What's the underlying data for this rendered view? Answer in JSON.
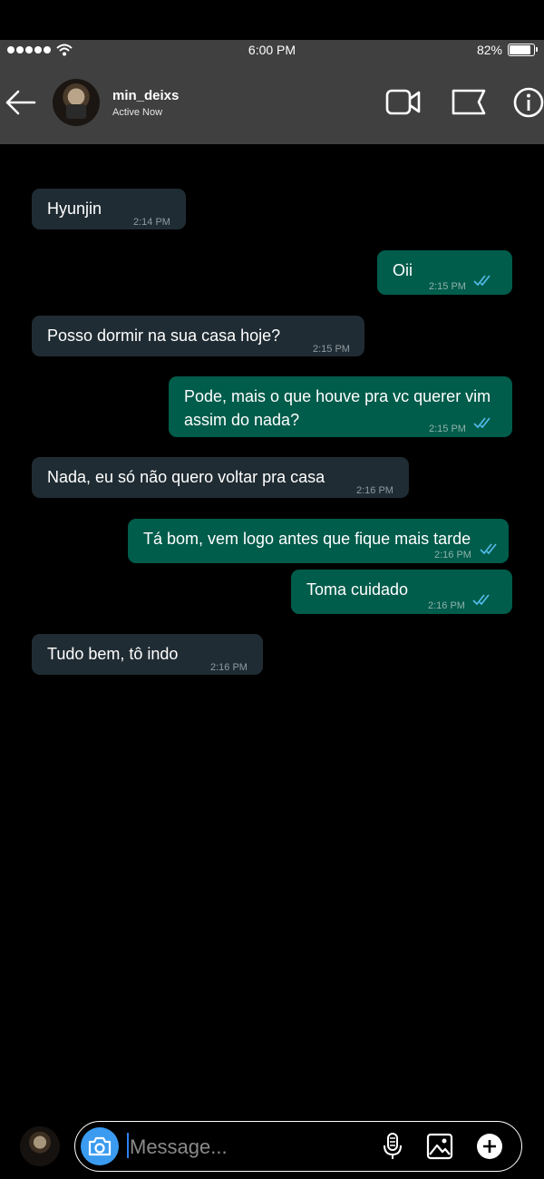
{
  "status_bar": {
    "time": "6:00 PM",
    "battery": "82%",
    "battery_level": 0.82
  },
  "header": {
    "username": "min_deixs",
    "status": "Active Now"
  },
  "messages": [
    {
      "text": "Hyunjin",
      "time": "2:14 PM",
      "direction": "incoming"
    },
    {
      "text": "Oii",
      "time": "2:15 PM",
      "direction": "outgoing",
      "read": true
    },
    {
      "text": "Posso dormir na sua casa hoje?",
      "time": "2:15 PM",
      "direction": "incoming"
    },
    {
      "text": "Pode, mais o que houve pra vc querer vim assim do nada?",
      "time": "2:15 PM",
      "direction": "outgoing",
      "read": true
    },
    {
      "text": "Nada, eu só não quero voltar pra casa",
      "time": "2:16 PM",
      "direction": "incoming"
    },
    {
      "text": "Tá bom, vem logo antes que fique mais tarde",
      "time": "2:16 PM",
      "direction": "outgoing",
      "read": true
    },
    {
      "text": "Toma cuidado",
      "time": "2:16 PM",
      "direction": "outgoing",
      "read": true
    },
    {
      "text": "Tudo bem, tô indo",
      "time": "2:16 PM",
      "direction": "incoming"
    }
  ],
  "composer": {
    "placeholder": "Message..."
  },
  "icons": {
    "back": "arrow-left-icon",
    "video": "video-camera-icon",
    "flag": "flag-icon",
    "info": "info-icon",
    "camera": "camera-icon",
    "mic": "microphone-icon",
    "gallery": "image-icon",
    "add": "plus-circle-icon",
    "read": "double-check-icon"
  },
  "colors": {
    "incoming_bubble": "#202c33",
    "outgoing_bubble": "#005c4b",
    "read_ticks": "#53bdeb",
    "camera_button": "#3a9bf0",
    "header": "#404040"
  }
}
